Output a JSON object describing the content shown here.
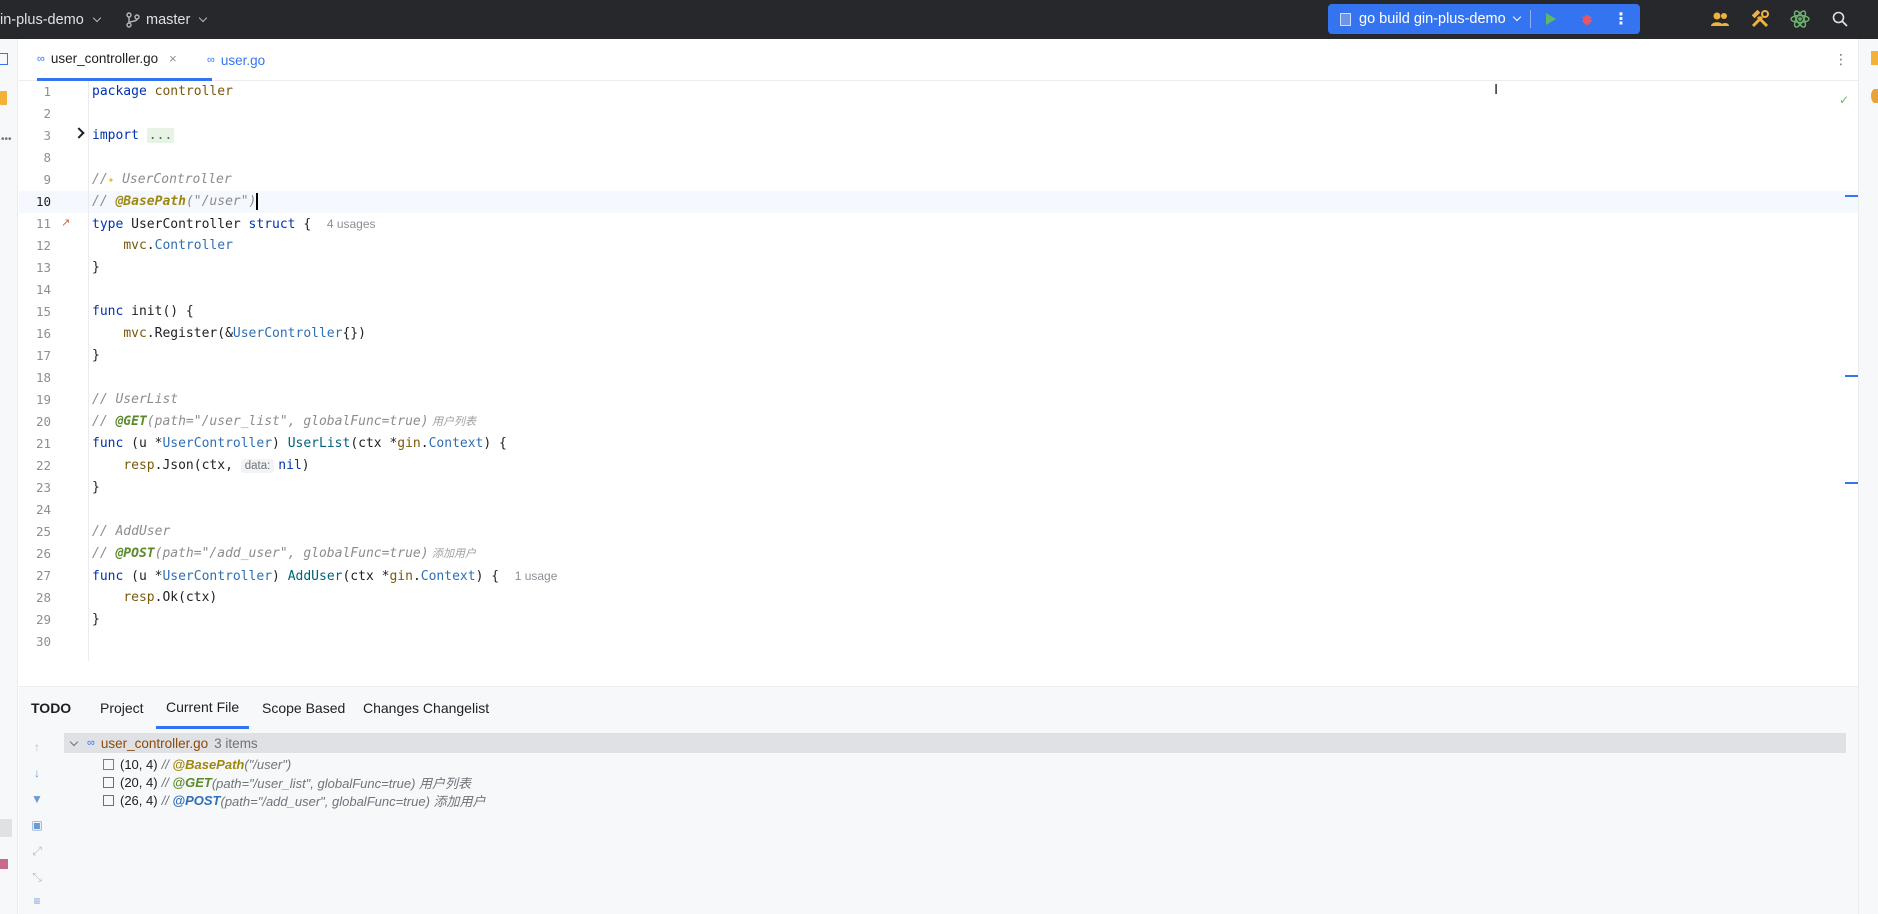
{
  "topbar": {
    "project": "in-plus-demo",
    "branch": "master",
    "run_config": "go build gin-plus-demo"
  },
  "tabs": [
    {
      "label": "user_controller.go",
      "active": true
    },
    {
      "label": "user.go",
      "active": false
    }
  ],
  "editor": {
    "current_line": 10,
    "line_numbers": [
      "1",
      "2",
      "3",
      "8",
      "9",
      "10",
      "11",
      "12",
      "13",
      "14",
      "15",
      "16",
      "17",
      "18",
      "19",
      "20",
      "21",
      "22",
      "23",
      "24",
      "25",
      "26",
      "27",
      "28",
      "29",
      "30"
    ],
    "l1": {
      "kw": "package",
      "name": "controller"
    },
    "l3": {
      "kw": "import",
      "fold": "..."
    },
    "l9": {
      "slash": "//",
      "text": " UserController"
    },
    "l10": {
      "slash": "// ",
      "ann": "@BasePath",
      "args": "(\"/user\")"
    },
    "l11": {
      "kw1": "type",
      "name": "UserController",
      "kw2": "struct",
      "brace": " {",
      "hint": "4 usages"
    },
    "l12": {
      "pkg": "mvc",
      "dot": ".",
      "ty": "Controller"
    },
    "l13": "}",
    "l15": {
      "kw": "func",
      "rest": " init() {"
    },
    "l16": {
      "pkg": "mvc",
      "call": ".Register(&",
      "ty": "UserController",
      "end": "{})"
    },
    "l17": "}",
    "l19": "// UserList",
    "l20": {
      "slash": "// ",
      "ann": "@GET",
      "args": "(path=\"/user_list\", globalFunc=true)",
      "zh": " 用户列表"
    },
    "l21": {
      "kw": "func",
      "recv": " (u *",
      "ty": "UserController",
      "mid": ") ",
      "fn": "UserList",
      "p1": "(ctx *",
      "pkg": "gin",
      "dot": ".",
      "ty2": "Context",
      "end": ") {"
    },
    "l22": {
      "pkg": "resp",
      "call": ".Json(ctx, ",
      "phint": "data:",
      "kwnil": "nil",
      "end": ")"
    },
    "l23": "}",
    "l25": "// AddUser",
    "l26": {
      "slash": "// ",
      "ann": "@POST",
      "args": "(path=\"/add_user\", globalFunc=true)",
      "zh": " 添加用户"
    },
    "l27": {
      "kw": "func",
      "recv": " (u *",
      "ty": "UserController",
      "mid": ") ",
      "fn": "AddUser",
      "p1": "(ctx *",
      "pkg": "gin",
      "dot": ".",
      "ty2": "Context",
      "end": ") {",
      "hint": "1 usage"
    },
    "l28": {
      "pkg": "resp",
      "call": ".Ok(ctx)"
    },
    "l29": "}"
  },
  "todo_panel": {
    "title": "TODO",
    "tabs": [
      "Project",
      "Current File",
      "Scope Based",
      "Changes Changelist"
    ],
    "active_tab": "Current File",
    "file": "user_controller.go",
    "count": "3 items",
    "items": [
      {
        "loc": "(10, 4)",
        "slash": "// ",
        "ann": "@BasePath",
        "rest": "(\"/user\")"
      },
      {
        "loc": "(20, 4)",
        "slash": "// ",
        "ann": "@GET",
        "rest": "(path=\"/user_list\", globalFunc=true) 用户列表"
      },
      {
        "loc": "(26, 4)",
        "slash": "// ",
        "ann": "@POST",
        "rest": "(path=\"/add_user\", globalFunc=true) 添加用户"
      }
    ]
  },
  "colors": {
    "accent": "#3574f0",
    "topbar": "#27282c",
    "annotation": "#9e880d",
    "keyword": "#0033b3"
  }
}
